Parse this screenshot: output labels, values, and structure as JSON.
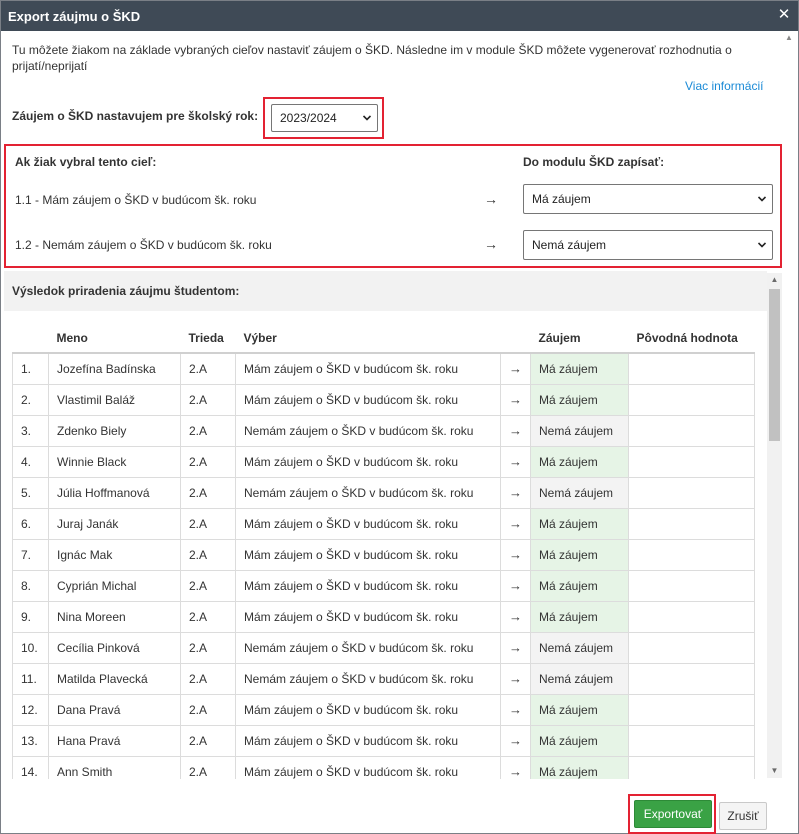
{
  "dialog": {
    "title": "Export záujmu o ŠKD",
    "close_icon": "close-icon"
  },
  "intro": {
    "text": "Tu môžete žiakom na základe vybraných cieľov nastaviť záujem o ŠKD. Následne im v module ŠKD môžete vygenerovať rozhodnutia o prijatí/neprijatí",
    "more_link": "Viac informácií"
  },
  "year": {
    "label": "Záujem o ŠKD nastavujem pre školský rok:",
    "selected": "2023/2024"
  },
  "mapping": {
    "head_left": "Ak žiak vybral tento cieľ:",
    "head_right": "Do modulu ŠKD zapísať:",
    "arrow": "→",
    "rows": [
      {
        "goal": "1.1 - Mám záujem o ŠKD v budúcom šk. roku",
        "selected": "Má záujem"
      },
      {
        "goal": "1.2 - Nemám záujem o ŠKD v budúcom šk. roku",
        "selected": "Nemá záujem"
      }
    ]
  },
  "result": {
    "title": "Výsledok priradenia záujmu študentom:",
    "columns": {
      "name": "Meno",
      "class": "Trieda",
      "choice": "Výber",
      "interest": "Záujem",
      "original": "Pôvodná hodnota"
    },
    "rows": [
      {
        "num": "1.",
        "name": "Jozefína Badínska",
        "class": "2.A",
        "choice": "Mám záujem o ŠKD v budúcom šk. roku",
        "arrow": "→",
        "interest": "Má záujem",
        "original": ""
      },
      {
        "num": "2.",
        "name": "Vlastimil Baláž",
        "class": "2.A",
        "choice": "Mám záujem o ŠKD v budúcom šk. roku",
        "arrow": "→",
        "interest": "Má záujem",
        "original": ""
      },
      {
        "num": "3.",
        "name": "Zdenko Biely",
        "class": "2.A",
        "choice": "Nemám záujem o ŠKD v budúcom šk. roku",
        "arrow": "→",
        "interest": "Nemá záujem",
        "original": ""
      },
      {
        "num": "4.",
        "name": "Winnie Black",
        "class": "2.A",
        "choice": "Mám záujem o ŠKD v budúcom šk. roku",
        "arrow": "→",
        "interest": "Má záujem",
        "original": ""
      },
      {
        "num": "5.",
        "name": "Júlia Hoffmanová",
        "class": "2.A",
        "choice": "Nemám záujem o ŠKD v budúcom šk. roku",
        "arrow": "→",
        "interest": "Nemá záujem",
        "original": ""
      },
      {
        "num": "6.",
        "name": "Juraj Janák",
        "class": "2.A",
        "choice": "Mám záujem o ŠKD v budúcom šk. roku",
        "arrow": "→",
        "interest": "Má záujem",
        "original": ""
      },
      {
        "num": "7.",
        "name": "Ignác Mak",
        "class": "2.A",
        "choice": "Mám záujem o ŠKD v budúcom šk. roku",
        "arrow": "→",
        "interest": "Má záujem",
        "original": ""
      },
      {
        "num": "8.",
        "name": "Cyprián Michal",
        "class": "2.A",
        "choice": "Mám záujem o ŠKD v budúcom šk. roku",
        "arrow": "→",
        "interest": "Má záujem",
        "original": ""
      },
      {
        "num": "9.",
        "name": "Nina Moreen",
        "class": "2.A",
        "choice": "Mám záujem o ŠKD v budúcom šk. roku",
        "arrow": "→",
        "interest": "Má záujem",
        "original": ""
      },
      {
        "num": "10.",
        "name": "Cecília Pinková",
        "class": "2.A",
        "choice": "Nemám záujem o ŠKD v budúcom šk. roku",
        "arrow": "→",
        "interest": "Nemá záujem",
        "original": ""
      },
      {
        "num": "11.",
        "name": "Matilda Plavecká",
        "class": "2.A",
        "choice": "Nemám záujem o ŠKD v budúcom šk. roku",
        "arrow": "→",
        "interest": "Nemá záujem",
        "original": ""
      },
      {
        "num": "12.",
        "name": "Dana Pravá",
        "class": "2.A",
        "choice": "Mám záujem o ŠKD v budúcom šk. roku",
        "arrow": "→",
        "interest": "Má záujem",
        "original": ""
      },
      {
        "num": "13.",
        "name": "Hana Pravá",
        "class": "2.A",
        "choice": "Mám záujem o ŠKD v budúcom šk. roku",
        "arrow": "→",
        "interest": "Má záujem",
        "original": ""
      },
      {
        "num": "14.",
        "name": "Ann Smith",
        "class": "2.A",
        "choice": "Mám záujem o ŠKD v budúcom šk. roku",
        "arrow": "→",
        "interest": "Má záujem",
        "original": ""
      }
    ]
  },
  "footer": {
    "export_label": "Exportovať",
    "cancel_label": "Zrušiť"
  },
  "colors": {
    "titlebar": "#3f4a56",
    "highlight": "#e32232",
    "export_button": "#3aa245",
    "interest_yes_bg": "#e6f4e6",
    "interest_no_bg": "#f3f3f3",
    "link": "#1a8ad6"
  }
}
